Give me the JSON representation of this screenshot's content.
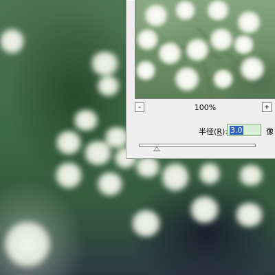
{
  "dialog": {
    "zoom": {
      "minus_label": "-",
      "plus_label": "+",
      "level": "100%"
    },
    "radius": {
      "label_prefix": "半径(",
      "label_accel": "R",
      "label_suffix": "):",
      "value": "3.0",
      "unit": "像",
      "slider_fraction": 0.15
    }
  },
  "icons": [
    "zoom-out-icon",
    "zoom-in-icon",
    "slider-thumb-icon"
  ]
}
